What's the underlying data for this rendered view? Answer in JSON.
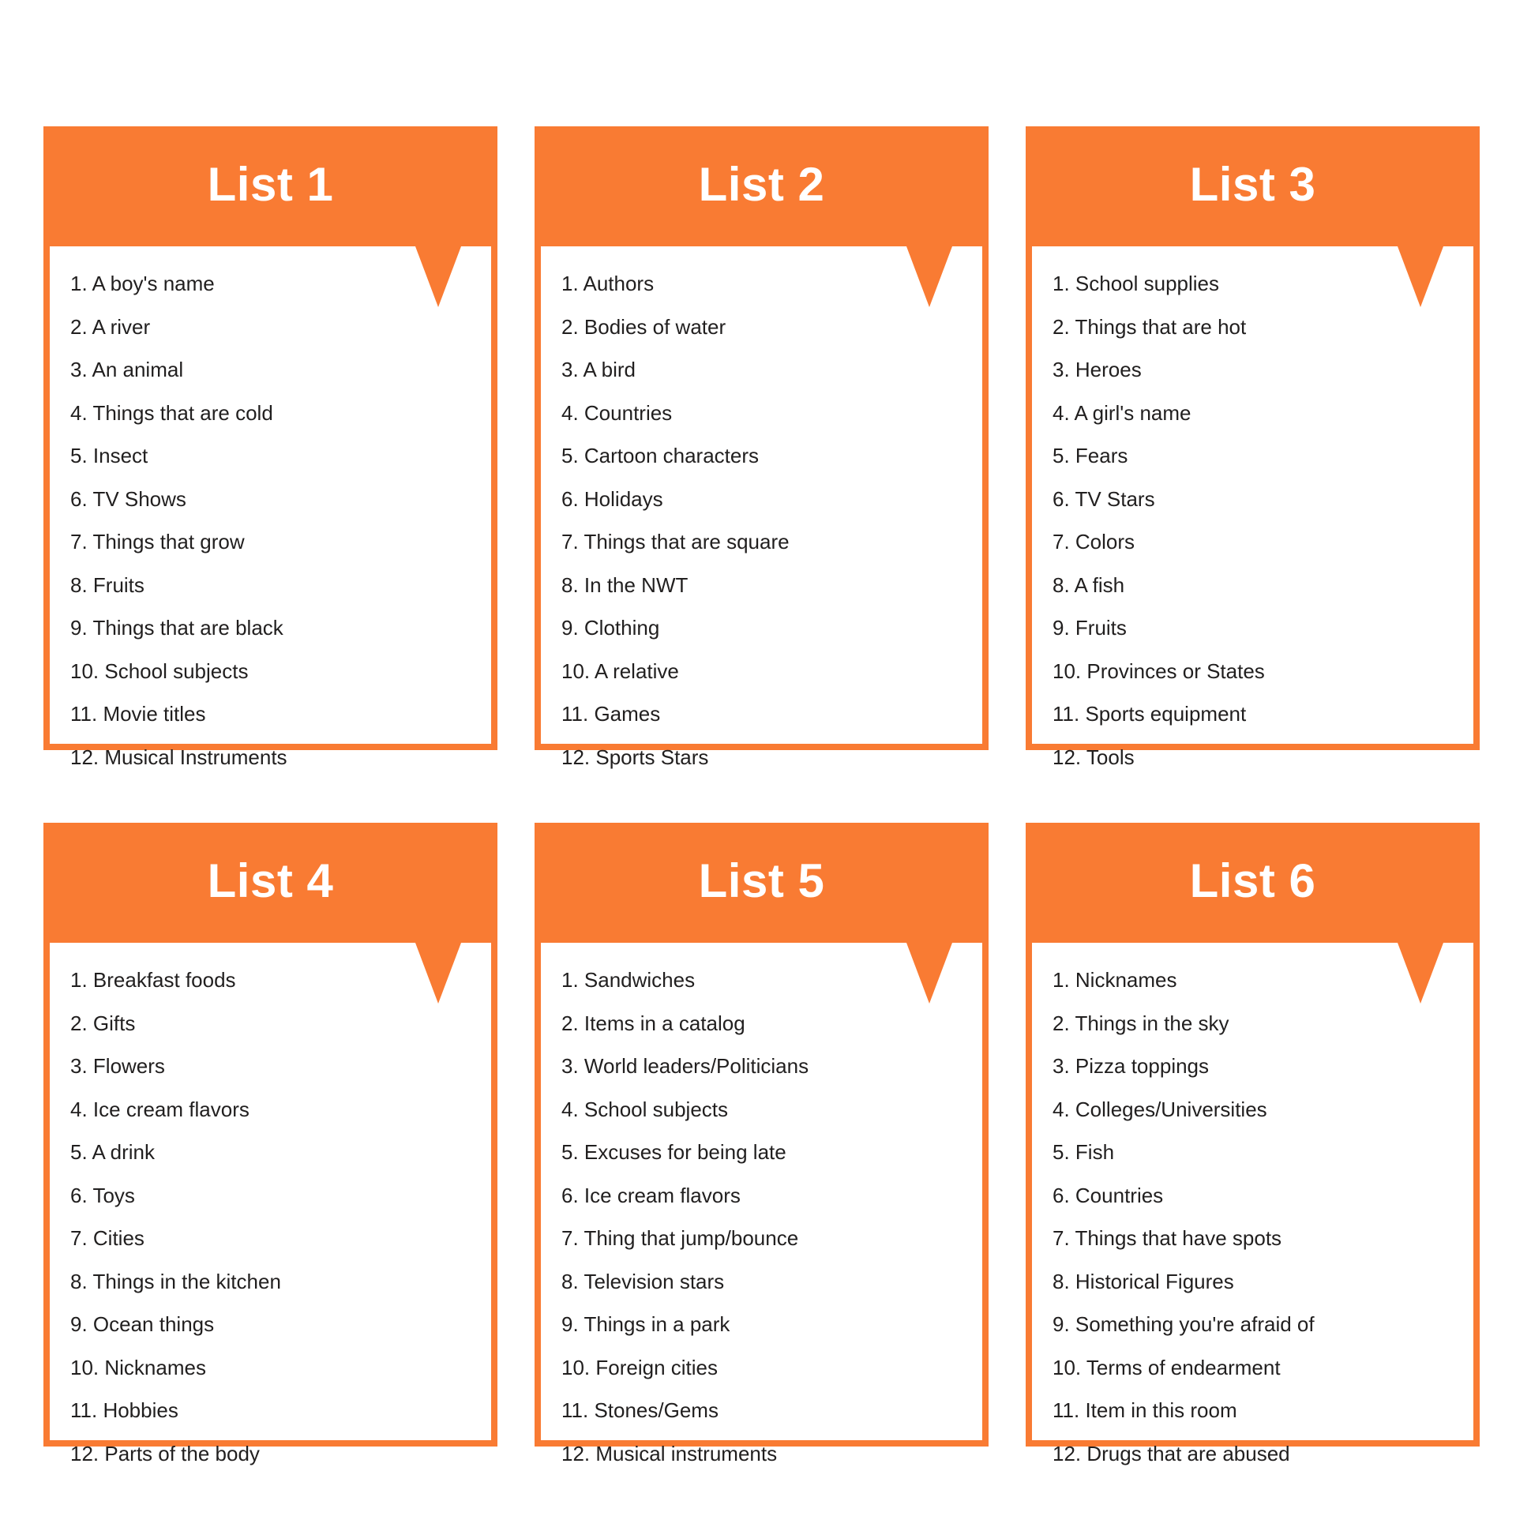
{
  "theme": {
    "accent": "#F97B33",
    "text": "#211F1F",
    "background": "#FFFFFF"
  },
  "cards": [
    {
      "title": "List 1",
      "items": [
        "1. A boy's name",
        "2. A river",
        "3. An animal",
        "4. Things that are cold",
        "5. Insect",
        "6. TV Shows",
        "7. Things that grow",
        "8. Fruits",
        "9. Things that are black",
        "10. School subjects",
        "11. Movie titles",
        "12. Musical Instruments"
      ]
    },
    {
      "title": "List 2",
      "items": [
        "1. Authors",
        "2. Bodies of water",
        "3. A bird",
        "4. Countries",
        "5. Cartoon characters",
        "6. Holidays",
        "7. Things that are square",
        "8. In the NWT",
        "9. Clothing",
        "10. A relative",
        "11. Games",
        "12. Sports Stars"
      ]
    },
    {
      "title": "List 3",
      "items": [
        "1. School supplies",
        "2. Things that are hot",
        "3. Heroes",
        "4. A girl's name",
        "5. Fears",
        "6. TV Stars",
        "7. Colors",
        "8. A fish",
        "9. Fruits",
        "10. Provinces or States",
        "11. Sports equipment",
        "12. Tools"
      ]
    },
    {
      "title": "List 4",
      "items": [
        "1. Breakfast foods",
        "2. Gifts",
        "3. Flowers",
        "4. Ice cream flavors",
        "5. A drink",
        "6. Toys",
        "7. Cities",
        "8. Things in the kitchen",
        "9. Ocean things",
        "10. Nicknames",
        "11. Hobbies",
        "12. Parts of the body"
      ]
    },
    {
      "title": "List 5",
      "items": [
        "1. Sandwiches",
        "2. Items in a catalog",
        "3. World leaders/Politicians",
        "4. School subjects",
        "5. Excuses for being late",
        "6. Ice cream flavors",
        "7. Thing that jump/bounce",
        "8. Television stars",
        "9. Things in a park",
        "10. Foreign cities",
        "11. Stones/Gems",
        "12. Musical instruments"
      ]
    },
    {
      "title": "List 6",
      "items": [
        "1. Nicknames",
        "2. Things in the sky",
        "3. Pizza toppings",
        "4. Colleges/Universities",
        "5. Fish",
        "6. Countries",
        "7. Things that have spots",
        "8. Historical Figures",
        "9. Something you're afraid of",
        "10. Terms of endearment",
        "11. Item in this room",
        "12. Drugs that are abused"
      ]
    }
  ]
}
